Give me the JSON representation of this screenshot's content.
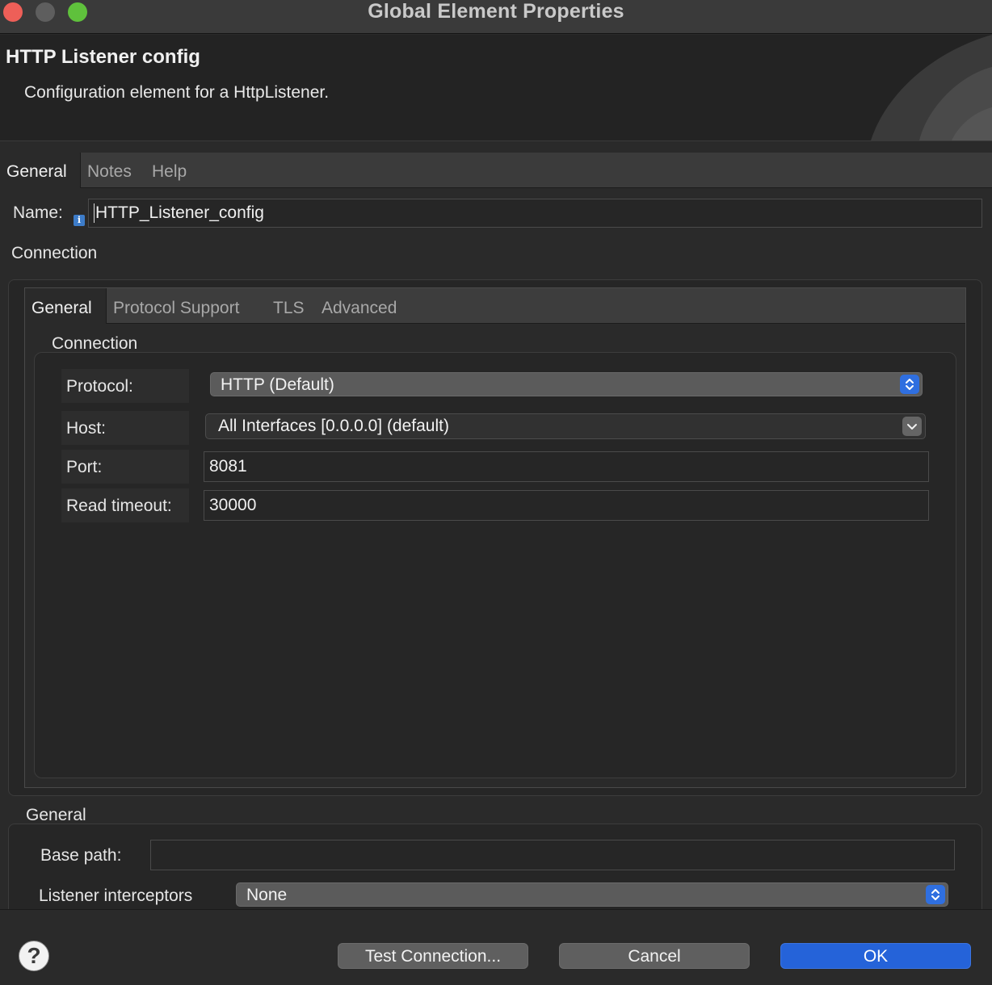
{
  "window": {
    "title": "Global Element Properties"
  },
  "header": {
    "title": "HTTP Listener config",
    "description": "Configuration element for a HttpListener."
  },
  "tabs": [
    "General",
    "Notes",
    "Help"
  ],
  "name": {
    "label": "Name:",
    "value": "HTTP_Listener_config"
  },
  "connection_section": {
    "label": "Connection"
  },
  "inner_tabs": [
    "General",
    "Protocol Support",
    "TLS",
    "Advanced"
  ],
  "connection_group": {
    "label": "Connection",
    "protocol": {
      "label": "Protocol:",
      "value": "HTTP (Default)"
    },
    "host": {
      "label": "Host:",
      "value": "All Interfaces [0.0.0.0] (default)"
    },
    "port": {
      "label": "Port:",
      "value": "8081"
    },
    "read_timeout": {
      "label": "Read timeout:",
      "value": "30000"
    }
  },
  "general_group": {
    "label": "General",
    "base_path": {
      "label": "Base path:",
      "value": ""
    },
    "listener_interceptors": {
      "label": "Listener interceptors",
      "value": "None"
    }
  },
  "footer": {
    "help": "?",
    "test_connection": "Test Connection...",
    "cancel": "Cancel",
    "ok": "OK"
  },
  "colors": {
    "accent": "#2563d9",
    "close": "#ee5f58",
    "maximize": "#5fc13c",
    "info_icon": "#3d7cc9"
  },
  "icons": {
    "info": "info-icon",
    "stepper": "chevron-up-down-icon",
    "dropdown": "chevron-down-icon",
    "help": "question-icon"
  }
}
